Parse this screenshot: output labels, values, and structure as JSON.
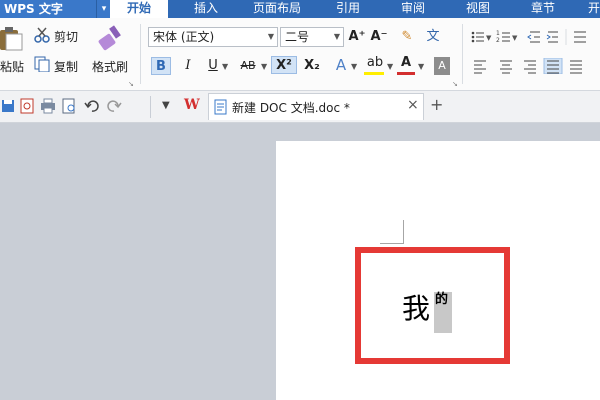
{
  "app": {
    "name": "WPS 文字",
    "menu_arrow": "▾"
  },
  "tabs": [
    {
      "label": "开始",
      "active": true
    },
    {
      "label": "插入"
    },
    {
      "label": "页面布局"
    },
    {
      "label": "引用"
    },
    {
      "label": "审阅"
    },
    {
      "label": "视图"
    },
    {
      "label": "章节"
    },
    {
      "label": "开"
    }
  ],
  "ribbon": {
    "paste_label": "粘贴",
    "cut_label": "剪切",
    "copy_label": "复制",
    "format_painter_label": "格式刷",
    "font_name": "宋体 (正文)",
    "font_size": "二号",
    "bold": "B",
    "italic": "I",
    "underline": "U",
    "strikethrough": "AB",
    "superscript": "X²",
    "subscript": "X₂",
    "text_effect": "A",
    "highlight": "ab",
    "font_color": "A",
    "char_shading": "A",
    "grow_font": "A⁺",
    "shrink_font": "A⁻",
    "clear_format": "✎",
    "phonetic": "文",
    "colors": {
      "font_color_bar": "#d32f2f",
      "highlight_bar": "#ffee00",
      "accent": "#2f69b5"
    }
  },
  "quick_access": {
    "doc_tab_label": "新建 DOC 文档.doc *",
    "close_glyph": "×",
    "new_tab_glyph": "+",
    "wps_logo": "W"
  },
  "document": {
    "main_text": "我",
    "annotation_text": "的"
  }
}
